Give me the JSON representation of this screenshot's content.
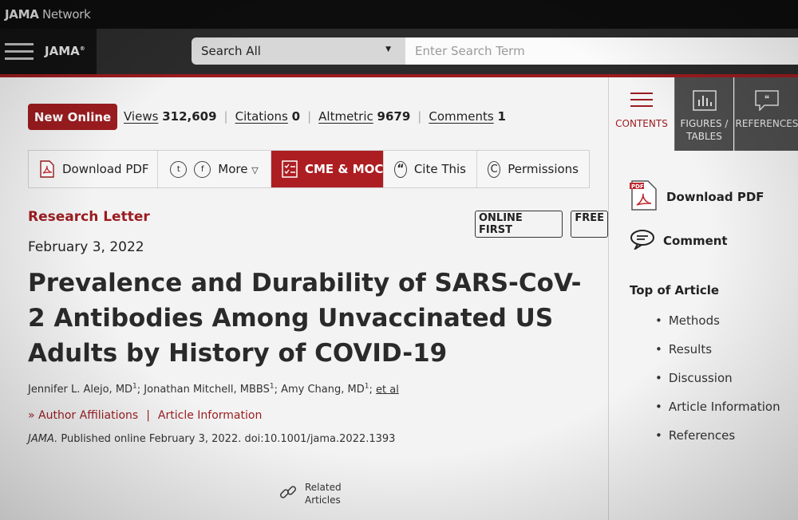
{
  "network": {
    "brand_bold": "JAMA",
    "brand_rest": " Network"
  },
  "header": {
    "journal": "JAMA",
    "journal_mark": "®",
    "search_scope": "Search All",
    "search_placeholder": "Enter Search Term"
  },
  "status": "New Online",
  "metrics": [
    {
      "label": "Views",
      "value": "312,609"
    },
    {
      "label": "Citations",
      "value": "0"
    },
    {
      "label": "Altmetric",
      "value": "9679"
    },
    {
      "label": "Comments",
      "value": "1"
    }
  ],
  "toolbar": {
    "download_pdf": "Download PDF",
    "more": "More",
    "cme": "CME & MOC",
    "cite": "Cite This",
    "permissions": "Permissions"
  },
  "article": {
    "type": "Research Letter",
    "badges": [
      "ONLINE FIRST",
      "FREE"
    ],
    "date": "February 3, 2022",
    "title": "Prevalence and Durability of SARS-CoV-2 Antibodies Among Unvaccinated US Adults by History of COVID-19",
    "authors": [
      {
        "name": "Jennifer L. Alejo, MD",
        "sup": "1"
      },
      {
        "name": "Jonathan Mitchell, MBBS",
        "sup": "1"
      },
      {
        "name": "Amy Chang, MD",
        "sup": "1"
      }
    ],
    "et_al": "et al",
    "author_affiliations": "Author Affiliations",
    "article_information": "Article Information",
    "journal_abbrev": "JAMA.",
    "citation_rest": " Published online February 3, 2022. doi:10.1001/jama.2022.1393",
    "related_line1": "Related",
    "related_line2": "Articles"
  },
  "sidebar": {
    "tabs": [
      {
        "line1": "CONTENTS",
        "line2": ""
      },
      {
        "line1": "FIGURES /",
        "line2": "TABLES"
      },
      {
        "line1": "REFERENCES",
        "line2": ""
      }
    ],
    "download_pdf": "Download PDF",
    "comment": "Comment",
    "top_heading": "Top of Article",
    "toc": [
      "Methods",
      "Results",
      "Discussion",
      "Article Information",
      "References"
    ]
  },
  "colors": {
    "accent": "#9b1c1f",
    "header_dark": "#2b2b2b",
    "tab_dark": "#4d4d4d"
  }
}
